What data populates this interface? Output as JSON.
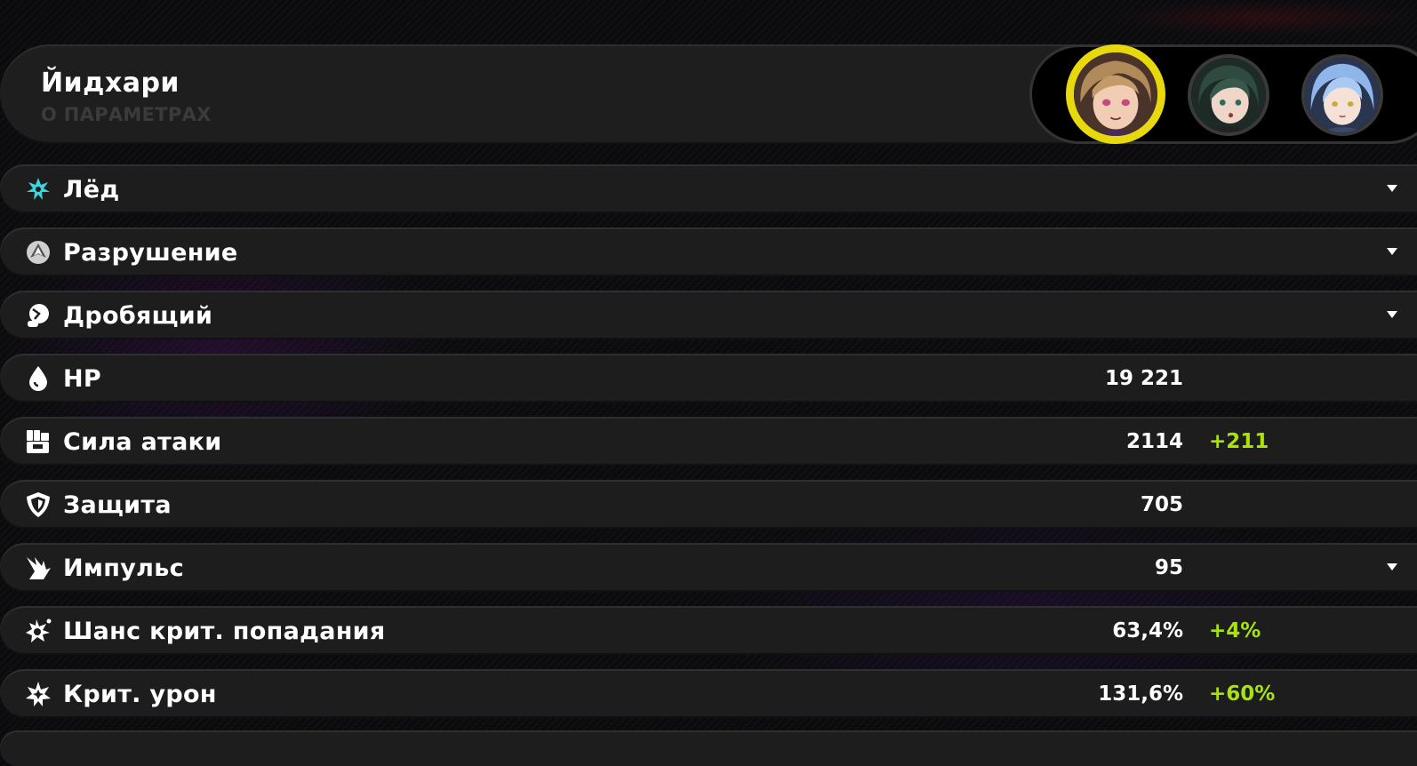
{
  "header": {
    "character_name": "Йидхари",
    "subtitle": "О ПАРАМЕТРАХ"
  },
  "character_switcher": {
    "active_border_color": "#e7d90e",
    "avatars": [
      {
        "icon": "character-avatar-brown-hair",
        "selected": true
      },
      {
        "icon": "character-avatar-green-hair",
        "selected": false
      },
      {
        "icon": "character-avatar-blue-hair",
        "selected": false
      }
    ]
  },
  "accent_colors": {
    "ice": "#3fd3dc",
    "bonus": "#a8e30e"
  },
  "rows": [
    {
      "label": "Лёд",
      "icon": "ice-element-icon",
      "value": "",
      "bonus": "",
      "expandable": true
    },
    {
      "label": "Разрушение",
      "icon": "rupture-specialty-icon",
      "value": "",
      "bonus": "",
      "expandable": true
    },
    {
      "label": "Дробящий",
      "icon": "strike-attack-type-icon",
      "value": "",
      "bonus": "",
      "expandable": true
    },
    {
      "label": "HP",
      "icon": "hp-drop-icon",
      "value": "19 221",
      "bonus": "",
      "expandable": false
    },
    {
      "label": "Сила атаки",
      "icon": "attack-fist-icon",
      "value": "2114",
      "bonus": "+211",
      "expandable": false
    },
    {
      "label": "Защита",
      "icon": "defense-shield-icon",
      "value": "705",
      "bonus": "",
      "expandable": false
    },
    {
      "label": "Импульс",
      "icon": "impact-icon",
      "value": "95",
      "bonus": "",
      "expandable": true
    },
    {
      "label": "Шанс крит. попадания",
      "icon": "crit-rate-star-icon",
      "value": "63,4%",
      "bonus": "+4%",
      "expandable": false
    },
    {
      "label": "Крит. урон",
      "icon": "crit-damage-star-icon",
      "value": "131,6%",
      "bonus": "+60%",
      "expandable": false
    }
  ]
}
